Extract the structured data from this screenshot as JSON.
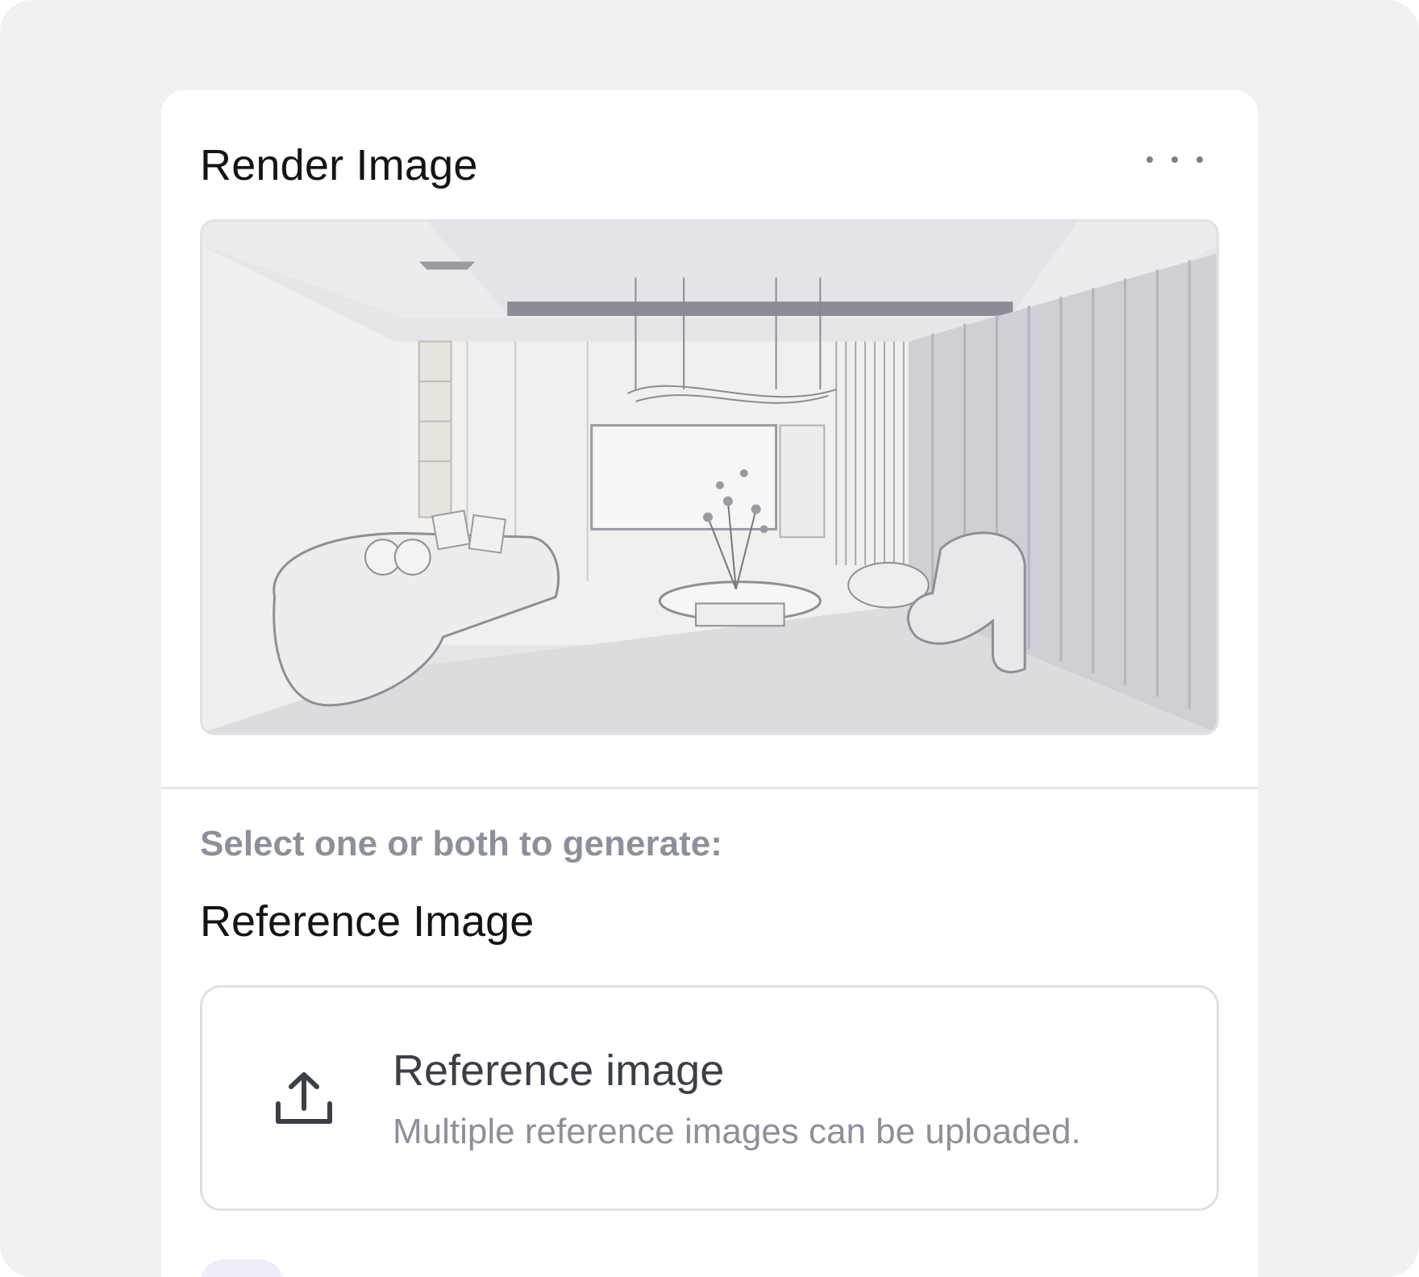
{
  "card": {
    "title": "Render Image",
    "more_icon": "more-horizontal-icon"
  },
  "preview": {
    "description": "line-art interior render of a living room"
  },
  "generate": {
    "prompt": "Select one or both to generate:"
  },
  "reference": {
    "section_label": "Reference Image",
    "upload_title": "Reference image",
    "upload_subtitle": "Multiple reference images can be uploaded.",
    "upload_icon": "upload-icon"
  },
  "colors": {
    "page_bg": "#f1f1f3",
    "card_bg": "#ffffff",
    "title_text": "#141414",
    "muted_text": "#8d909a",
    "border": "#e0e0e4",
    "accent_pill": "#efedf8"
  }
}
